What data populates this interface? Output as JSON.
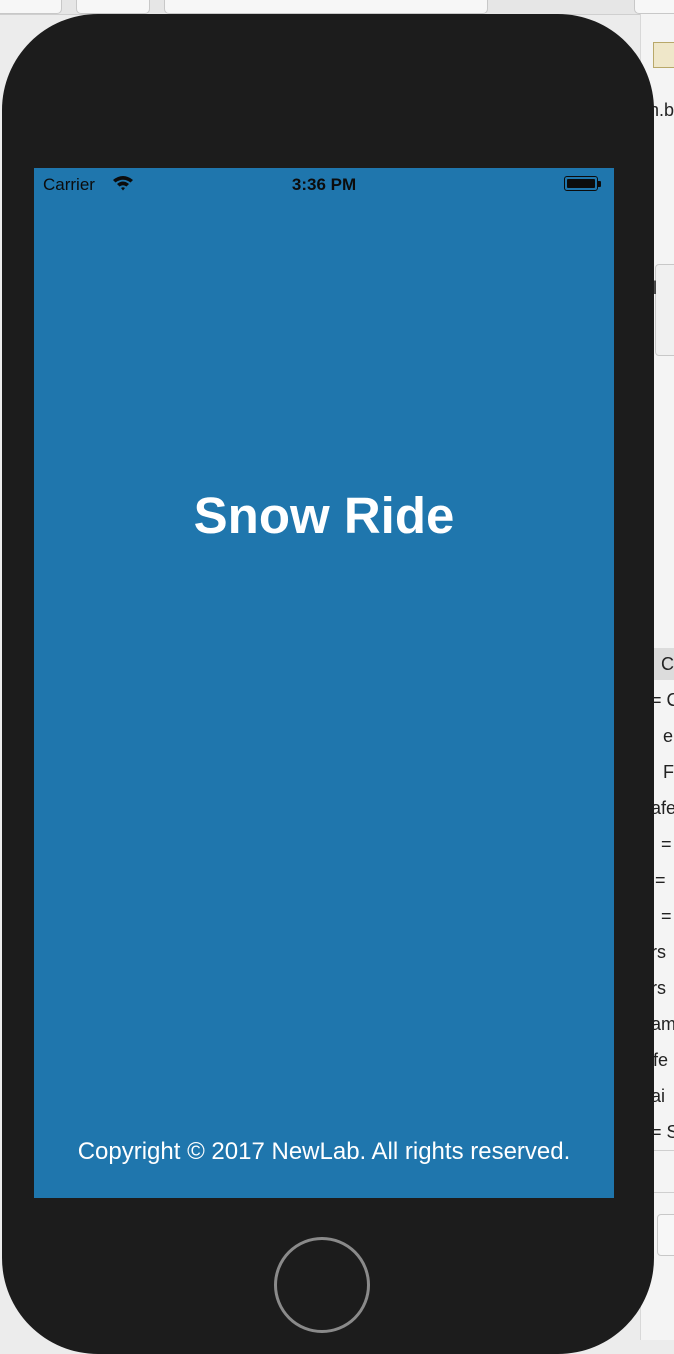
{
  "xcode_sidebar": {
    "lines": [
      "n.b",
      "ll",
      "C",
      "= C",
      "e",
      "F",
      "afe",
      "=",
      "=",
      "=",
      "rs",
      "rs",
      "am",
      "fe",
      "ai",
      "= S"
    ]
  },
  "device": {
    "status_bar": {
      "carrier": "Carrier",
      "time": "3:36 PM",
      "wifi_icon": "wifi-icon",
      "battery_icon": "battery-icon"
    },
    "app_title": "Snow Ride",
    "copyright": "Copyright © 2017 NewLab. All rights reserved.",
    "screen_color": "#1f76ad",
    "home_button_icon": "home-button-icon"
  }
}
